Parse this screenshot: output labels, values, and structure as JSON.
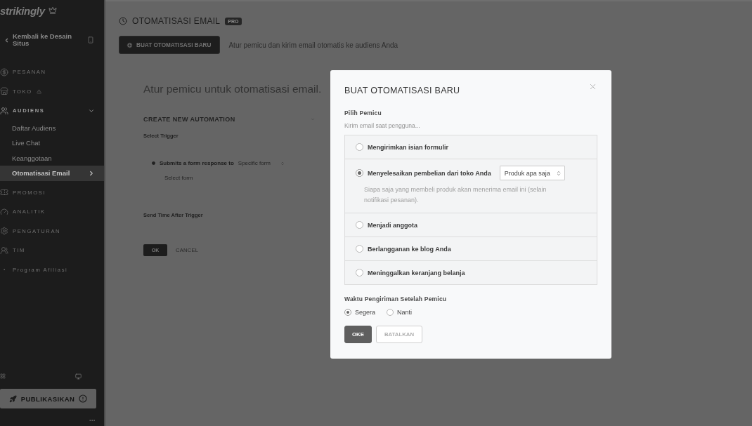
{
  "sidebar": {
    "logo": "strikingly",
    "back_link": "Kembali ke Desain Situs",
    "items": [
      {
        "label": "PESANAN",
        "selected": false
      },
      {
        "label": "TOKO",
        "selected": false,
        "alert": true
      },
      {
        "label": "AUDIENS",
        "selected": false,
        "expanded": true,
        "children": [
          {
            "label": "Daftar Audiens",
            "selected": false
          },
          {
            "label": "Live Chat",
            "selected": false
          },
          {
            "label": "Keanggotaan",
            "selected": false
          },
          {
            "label": "Otomatisasi Email",
            "selected": true
          }
        ]
      },
      {
        "label": "PROMOSI",
        "selected": false
      },
      {
        "label": "ANALITIK",
        "selected": false
      },
      {
        "label": "PENGATURAN",
        "selected": false
      },
      {
        "label": "TIM",
        "selected": false
      },
      {
        "label": "Program Afiliasi",
        "selected": false
      }
    ],
    "publish_button": {
      "label": "PUBLIKASIKAN",
      "alert": true
    }
  },
  "header": {
    "title": "OTOMATISASI EMAIL",
    "badge": "PRO",
    "new_button": "BUAT OTOMATISASI BARU",
    "subtitle": "Atur pemicu dan kirim email otomatis ke audiens Anda"
  },
  "background_form": {
    "heading": "Atur pemicu untuk otomatisasi email.",
    "section_title": "CREATE NEW AUTOMATION",
    "trigger_label": "Select Trigger",
    "trigger": {
      "label": "Submits a form response to",
      "selected": true,
      "select_value": "Specific form"
    },
    "form_select": "Select form",
    "send_time_label": "Send Time After Trigger",
    "buttons": [
      {
        "label": "OK",
        "kind": "primary"
      },
      {
        "label": "CANCEL",
        "kind": "link"
      }
    ]
  },
  "modal": {
    "title": "BUAT OTOMATISASI BARU",
    "trigger_label": "Pilih Pemicu",
    "trigger_hint": "Kirim email saat pengguna...",
    "triggers": [
      {
        "label": "Mengirimkan isian formulir",
        "selected": false
      },
      {
        "label": "Menyelesaikan pembelian dari toko Anda",
        "selected": true,
        "select_value": "Produk apa saja",
        "description": "Siapa saja yang membeli produk akan menerima email ini (selain notifikasi pesanan)."
      },
      {
        "label": "Menjadi anggota",
        "selected": false
      },
      {
        "label": "Berlangganan ke blog Anda",
        "selected": false
      },
      {
        "label": "Meninggalkan keranjang belanja",
        "selected": false
      }
    ],
    "send_time_label": "Waktu Pengiriman Setelah Pemicu",
    "send_time_options": [
      {
        "label": "Segera",
        "selected": true
      },
      {
        "label": "Nanti",
        "selected": false
      }
    ],
    "buttons": [
      {
        "label": "OKE",
        "kind": "primary"
      },
      {
        "label": "BATALKAN",
        "kind": "secondary"
      }
    ]
  }
}
